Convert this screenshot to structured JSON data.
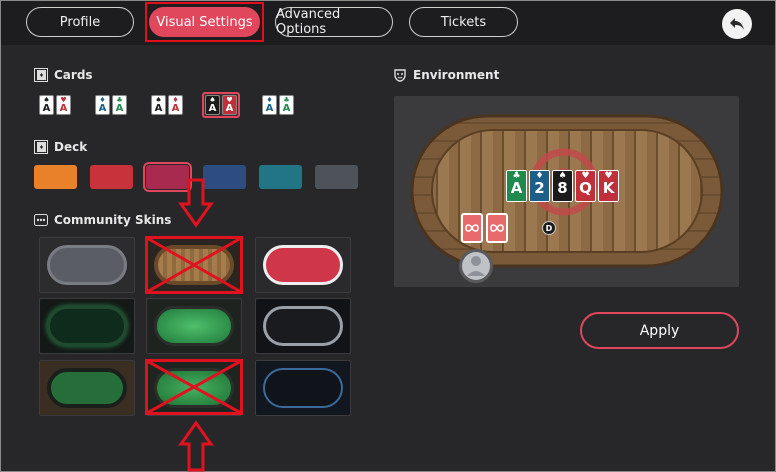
{
  "tabs": [
    {
      "label": "Profile",
      "active": false
    },
    {
      "label": "Visual Settings",
      "active": true
    },
    {
      "label": "Advanced Options",
      "active": false
    },
    {
      "label": "Tickets",
      "active": false
    }
  ],
  "sections": {
    "cards": {
      "label": "Cards"
    },
    "deck": {
      "label": "Deck"
    },
    "community_skins": {
      "label": "Community Skins"
    },
    "environment": {
      "label": "Environment"
    }
  },
  "card_rank": "A",
  "deck_colors": [
    "#e9802a",
    "#c8323a",
    "#a82a4e",
    "#2d4d80",
    "#217585",
    "#4e5359"
  ],
  "selected_deck_index": 2,
  "selected_card_index": 3,
  "preview": {
    "board": [
      {
        "rank": "A",
        "suit": "♣",
        "color": "#1f8a4c"
      },
      {
        "rank": "2",
        "suit": "♦",
        "color": "#1e5f8a"
      },
      {
        "rank": "8",
        "suit": "♠",
        "color": "#1b1b1b"
      },
      {
        "rank": "Q",
        "suit": "♥",
        "color": "#c0303a"
      },
      {
        "rank": "K",
        "suit": "♥",
        "color": "#c0303a"
      }
    ],
    "dealer_label": "D"
  },
  "apply_label": "Apply",
  "colors": {
    "accent": "#e0475c",
    "annotation": "#e00f1e"
  }
}
